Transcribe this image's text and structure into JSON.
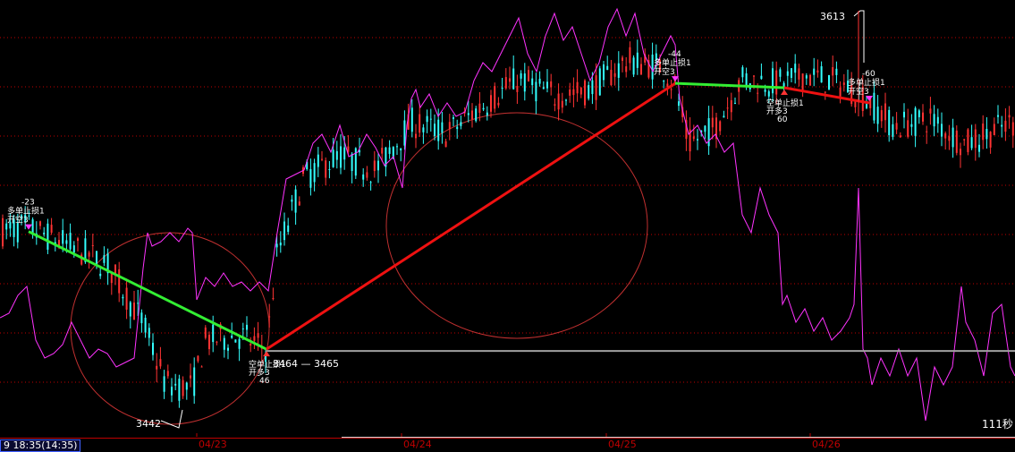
{
  "chart_data": {
    "type": "candlestick",
    "x_ticks": [
      "04/23",
      "04/24",
      "04/25",
      "04/26"
    ],
    "ylim": [
      3425,
      3625
    ],
    "price_labels": [
      {
        "text": "3613",
        "price": 3613
      },
      {
        "text": "3442",
        "price": 3442
      },
      {
        "text": "3464 — 3465",
        "price": 3466
      }
    ],
    "horizontal_line": 3466,
    "trend_lines": [
      {
        "from": {
          "x": 32,
          "y": 3520
        },
        "to": {
          "x": 298,
          "y": 3466
        },
        "color": "#33ee33"
      },
      {
        "from": {
          "x": 298,
          "y": 3466
        },
        "to": {
          "x": 755,
          "y": 3588
        },
        "color": "#ee1111"
      },
      {
        "from": {
          "x": 755,
          "y": 3588
        },
        "to": {
          "x": 877,
          "y": 3586
        },
        "color": "#33ee33"
      },
      {
        "from": {
          "x": 877,
          "y": 3586
        },
        "to": {
          "x": 972,
          "y": 3579
        },
        "color": "#ee1111"
      }
    ],
    "signals": [
      {
        "x": 32,
        "y": 3520,
        "dir": "down",
        "color": "#ff33ff",
        "lines": [
          "-23",
          "多单止损1",
          "开空3"
        ]
      },
      {
        "x": 298,
        "y": 3466,
        "dir": "up",
        "color": "#ff3333",
        "lines": [
          "空单止损1",
          "开多3",
          "46"
        ]
      },
      {
        "x": 755,
        "y": 3588,
        "dir": "down",
        "color": "#ff33ff",
        "lines": [
          "-44",
          "多单止损1",
          "开空3"
        ]
      },
      {
        "x": 877,
        "y": 3586,
        "dir": "up",
        "color": "#ff3333",
        "lines": [
          "空单止损1",
          "开多3",
          "60"
        ]
      },
      {
        "x": 972,
        "y": 3579,
        "dir": "down",
        "color": "#ff33ff",
        "lines": [
          "-60",
          "多单止损1",
          "开空3"
        ]
      }
    ],
    "grid": true,
    "colors": {
      "up": "#ff3333",
      "down": "#33ffff",
      "indicator": "#ff33ff",
      "grid": "#c00000"
    }
  },
  "status": {
    "time": "9 18:35(14:35)",
    "timer": "111秒"
  }
}
